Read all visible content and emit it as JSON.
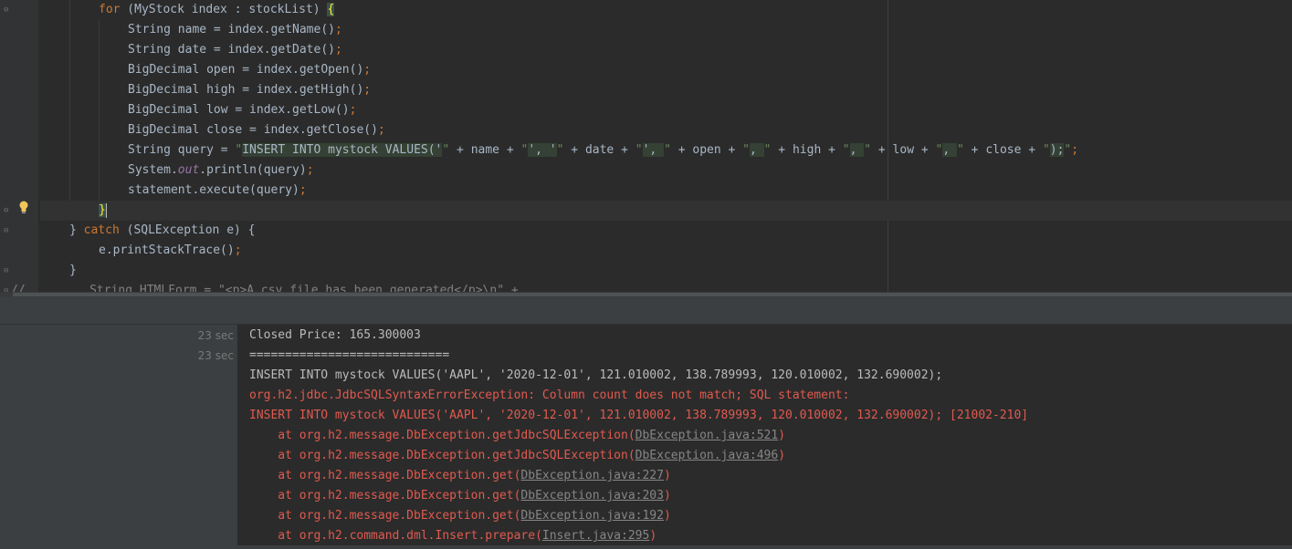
{
  "editor": {
    "lines": {
      "l1": {
        "kw_for": "for",
        "a": " (MyStock index : stockList) ",
        "brace": "{"
      },
      "l2": {
        "a": "String name = index.getName()",
        "semi": ";"
      },
      "l3": {
        "a": "String date = index.getDate()",
        "semi": ";"
      },
      "l4": {
        "a": "BigDecimal open = index.getOpen()",
        "semi": ";"
      },
      "l5": {
        "a": "BigDecimal high = index.getHigh()",
        "semi": ";"
      },
      "l6": {
        "a": "BigDecimal low = index.getLow()",
        "semi": ";"
      },
      "l7": {
        "a": "BigDecimal close = index.getClose()",
        "semi": ";"
      },
      "l8": {
        "a": "String query = ",
        "s1q": "\"",
        "s1": "INSERT INTO mystock VALUES('",
        "s1e": "\"",
        "b": " + name + ",
        "s2q": "\"",
        "s2": "', '",
        "s2e": "\"",
        "c": " + date + ",
        "s3q": "\"",
        "s3": "', ",
        "s3e": "\"",
        "d": " + open + ",
        "s4q": "\"",
        "s4": ", ",
        "s4e": "\"",
        "e": " + high + ",
        "s5q": "\"",
        "s5": ", ",
        "s5e": "\"",
        "f": " + low + ",
        "s6q": "\"",
        "s6": ", ",
        "s6e": "\"",
        "g": " + close + ",
        "s7q": "\"",
        "s7": ");",
        "s7e": "\"",
        "semi": ";"
      },
      "l9": {
        "a": "System.",
        "out": "out",
        "b": ".println(query)",
        "semi": ";"
      },
      "l10": {
        "a": "statement.execute(query)",
        "semi": ";"
      },
      "l11": {
        "brace": "}"
      },
      "l12": {
        "a": "} ",
        "kw_catch": "catch",
        "b": " (SQLException e) {"
      },
      "l13": {
        "a": "e.printStackTrace()",
        "semi": ";"
      },
      "l14": {
        "a": "}"
      },
      "l15": {
        "a": "//         String HTMLForm = \"<p>A csv file has been generated</p>\\n\" +"
      }
    }
  },
  "console": {
    "timestamps": [
      "23 sec",
      "23 sec"
    ],
    "lines": {
      "o1": "Closed Price: 165.300003",
      "o2": "============================",
      "o3": "INSERT INTO mystock VALUES('AAPL', '2020-12-01', 121.010002, 138.789993, 120.010002, 132.690002);",
      "o4": "org.h2.jdbc.JdbcSQLSyntaxErrorException: Column count does not match; SQL statement:",
      "o5": "INSERT INTO mystock VALUES('AAPL', '2020-12-01', 121.010002, 138.789993, 120.010002, 132.690002); [21002-210]",
      "st1": {
        "pre": "    at org.h2.message.DbException.getJdbcSQLException(",
        "link": "DbException.java:521",
        "post": ")"
      },
      "st2": {
        "pre": "    at org.h2.message.DbException.getJdbcSQLException(",
        "link": "DbException.java:496",
        "post": ")"
      },
      "st3": {
        "pre": "    at org.h2.message.DbException.get(",
        "link": "DbException.java:227",
        "post": ")"
      },
      "st4": {
        "pre": "    at org.h2.message.DbException.get(",
        "link": "DbException.java:203",
        "post": ")"
      },
      "st5": {
        "pre": "    at org.h2.message.DbException.get(",
        "link": "DbException.java:192",
        "post": ")"
      },
      "st6": {
        "pre": "    at org.h2.command.dml.Insert.prepare(",
        "link": "Insert.java:295",
        "post": ")"
      }
    }
  },
  "icons": {
    "gutter_bulb": "lightbulb-icon",
    "fold": "fold-marker-icon"
  }
}
